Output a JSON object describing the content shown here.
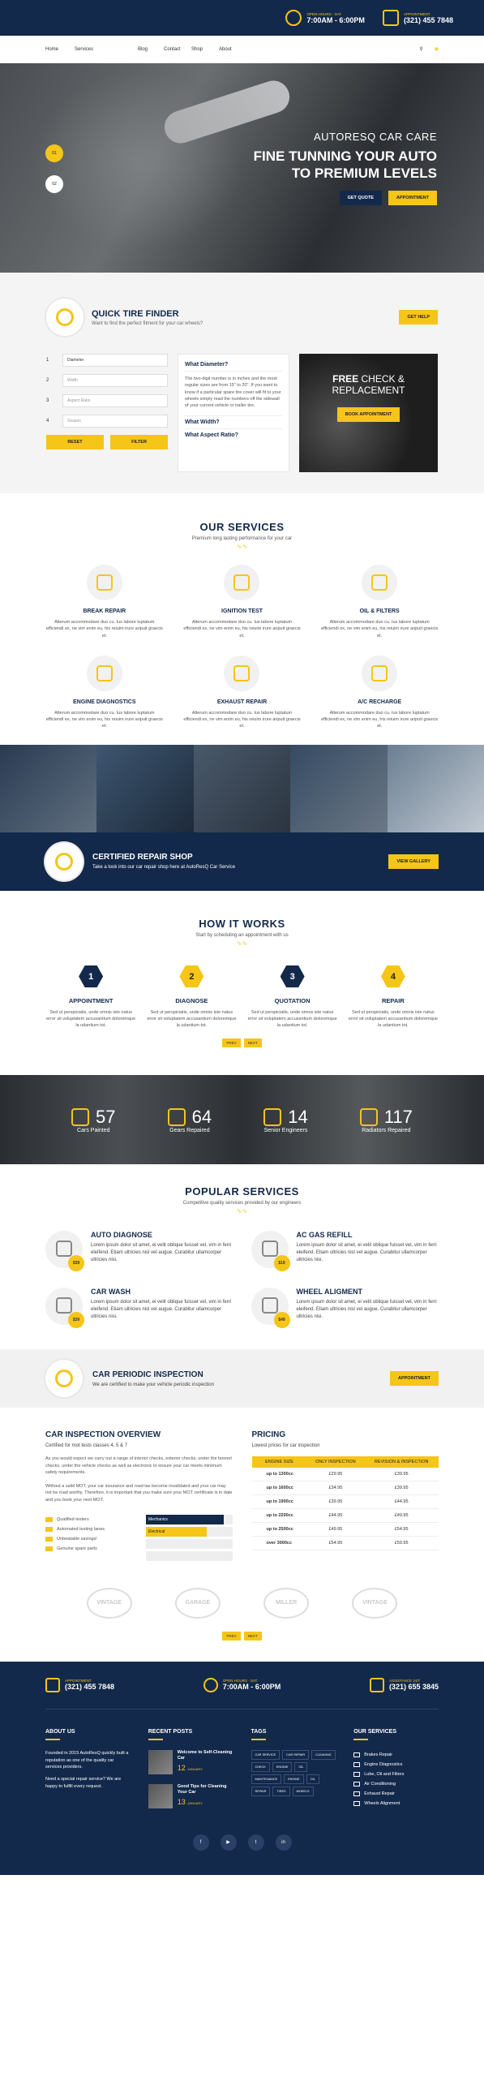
{
  "topbar": {
    "hours_label": "OPEN HOURS - SAT",
    "hours": "7:00AM - 6:00PM",
    "appt_label": "APPOINTMENT",
    "phone": "(321) 455 7848"
  },
  "nav": {
    "items": [
      "Home",
      "Services",
      "Blog",
      "Contact",
      "Shop",
      "About"
    ]
  },
  "hero": {
    "subtitle": "AUTORESQ CAR CARE",
    "title1": "FINE TUNNING YOUR AUTO",
    "title2": "TO PREMIUM LEVELS",
    "btn1": "GET QUOTE",
    "btn2": "APPOINTMENT",
    "slide1": "01",
    "slide2": "02"
  },
  "tire": {
    "title": "QUICK TIRE FINDER",
    "sub": "Want to find the perfect fitment for your car wheels?",
    "help": "GET HELP",
    "rows": [
      {
        "n": "1",
        "v": "Diameter"
      },
      {
        "n": "2",
        "v": "Width"
      },
      {
        "n": "3",
        "v": "Aspect Ratio"
      },
      {
        "n": "4",
        "v": "Season"
      }
    ],
    "reset": "RESET",
    "filter": "FILTER",
    "acc1": "What Diameter?",
    "acc_text": "The two-digit number is in inches and the most regular sizes are from 15\" to 20\". If you want to know if a particular spare tire cover will fit to your wheels simply read the numbers off the sidewall of your current vehicle or trailer tire.",
    "acc2": "What Width?",
    "acc3": "What Aspect Ratio?",
    "free1": "FREE",
    "free2": "CHECK &",
    "free3": "REPLACEMENT",
    "book": "BOOK APPOINTMENT"
  },
  "services": {
    "title": "OUR SERVICES",
    "sub": "Premium long lasting performance for your car",
    "desc": "Alterum accommodare duo cu. Ius labore luptatum efficiendi ex, ne vim enim eu, his reiuim irure aripuit graecis et.",
    "items": [
      "BREAK REPAIR",
      "IGNITION TEST",
      "OIL & FILTERS",
      "ENGINE DIAGNOSTICS",
      "EXHAUST REPAIR",
      "A/C RECHARGE"
    ]
  },
  "cert": {
    "title": "CERTIFIED REPAIR SHOP",
    "sub": "Take a look into our car repair shop here at AutoResQ Car Service",
    "btn": "VIEW GALLERY"
  },
  "how": {
    "title": "HOW IT WORKS",
    "sub": "Start by scheduling an appointment with us",
    "desc": "Sed ut perspiciatis, unde omnis iste natus error sit voluptatem accusantium doloremque la udantium tot.",
    "steps": [
      {
        "n": "1",
        "t": "APPOINTMENT"
      },
      {
        "n": "2",
        "t": "DIAGNOSE"
      },
      {
        "n": "3",
        "t": "QUOTATION"
      },
      {
        "n": "4",
        "t": "REPAIR"
      }
    ],
    "prev": "PREV",
    "next": "NEXT"
  },
  "stats": [
    {
      "v": "57",
      "l": "Cars Painted"
    },
    {
      "v": "64",
      "l": "Gears Repaired"
    },
    {
      "v": "14",
      "l": "Senior Engineers"
    },
    {
      "v": "117",
      "l": "Radiators Repaired"
    }
  ],
  "popular": {
    "title": "POPULAR SERVICES",
    "sub": "Competitive quality services provided by our engineers",
    "desc": "Lorem ipsum dolor sit amet, ei velit oblique fuisset vel, vim in ferri eleifend. Etiam ultricies nisl vel augue. Curabitur ullamcorper ultricies nisi.",
    "items": [
      {
        "t": "AUTO DIAGNOSE",
        "p": "$39"
      },
      {
        "t": "AC GAS REFILL",
        "p": "$19"
      },
      {
        "t": "CAR WASH",
        "p": "$39"
      },
      {
        "t": "WHEEL ALIGMENT",
        "p": "$49"
      }
    ]
  },
  "periodic": {
    "title": "CAR PERIODIC INSPECTION",
    "sub": "We are certified to make your vehicle periodic inspection",
    "btn": "APPOINTMENT"
  },
  "overview": {
    "title": "CAR INSPECTION OVERVIEW",
    "sub": "Certified for mot tests classes 4, 5 & 7",
    "p1": "As you would expect we carry out a range of interior checks, exterior checks, under the bonnet checks, under the vehicle checks as well as electronic to ensure your car meets minimum safety requirements.",
    "p2": "Without a valid MOT, your car insurance and road tax become invalidated and your car may not be road worthy. Therefore, it is important that you make sure your MOT certificate is in date and you book your next MOT.",
    "checks": [
      "Qualified testers",
      "Automated testing lanes",
      "Unbeatable savings!",
      "Genuine spare parts"
    ],
    "bars": [
      {
        "l": "Mechanics",
        "v": 0.9,
        "c": "#13294b"
      },
      {
        "l": "Electrical",
        "v": 0.7,
        "c": "#f5c518"
      },
      {
        "l": "",
        "v": 0,
        "c": "#ccc"
      },
      {
        "l": "",
        "v": 0,
        "c": "#ccc"
      }
    ]
  },
  "pricing": {
    "title": "PRICING",
    "sub": "Lowest prices for car inspection",
    "headers": [
      "ENGINE SIZE",
      "ONLY INSPECTION",
      "REVISION & INSPECTION"
    ],
    "rows": [
      [
        "up to 1300cc",
        "£29.95",
        "£39.95"
      ],
      [
        "up to 1600cc",
        "£34.95",
        "£39.95"
      ],
      [
        "up to 1900cc",
        "£39.95",
        "£44.95"
      ],
      [
        "up to 2200cc",
        "£44.95",
        "£49.95"
      ],
      [
        "up to 2500cc",
        "£49.95",
        "£54.95"
      ],
      [
        "over 3000cc",
        "£54.95",
        "£59.95"
      ]
    ]
  },
  "partners": [
    "VINTAGE",
    "GARAGE",
    "MILLER",
    "VINTAGE"
  ],
  "pager2": {
    "prev": "PREV",
    "next": "NEXT"
  },
  "footer": {
    "appt_label": "APPOINTMENT",
    "phone": "(321) 455 7848",
    "hours_label": "OPEN HOURS - SAT",
    "hours": "7:00AM - 6:00PM",
    "assist_label": "ASSISTANCE 24/7",
    "assist": "(321) 655 3845",
    "about_h": "ABOUT US",
    "about1": "Founded in 2015 AutoResQ quickly built a reputation as one of the quality car services providers.",
    "about2": "Need a special repair service? We are happy to fulfill every request.",
    "posts_h": "RECENT POSTS",
    "posts": [
      {
        "t": "Welcome to Self-Cleaning Car",
        "d": "12",
        "m": "JANUARY"
      },
      {
        "t": "Good Tips for Cleaning Your Car",
        "d": "13",
        "m": "JANUARY"
      }
    ],
    "tags_h": "TAGS",
    "tags": [
      "CAR SERVICE",
      "CAR REPAIR",
      "CLEANING",
      "CHECK",
      "ENGINE",
      "OIL",
      "MAINTENANCE",
      "ENGINE",
      "OIL",
      "REPAIR",
      "TIRES",
      "WHEELS"
    ],
    "svc_h": "OUR SERVICES",
    "svcs": [
      "Brakes Repair",
      "Engine Diagnostics",
      "Lube, Oil and Filters",
      "Air Conditioning",
      "Exhaust Repair",
      "Wheels Alignment"
    ],
    "social": [
      "f",
      "▶",
      "t",
      "in"
    ]
  }
}
